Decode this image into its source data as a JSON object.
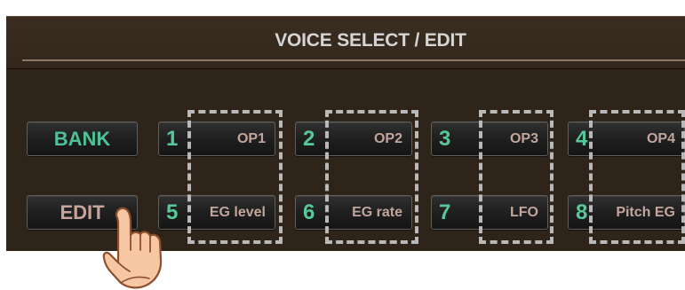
{
  "screen": {
    "title": "VOICE SELECT / EDIT"
  },
  "buttons": {
    "bank": "BANK",
    "edit": "EDIT"
  },
  "operator_buttons": [
    {
      "number": "1",
      "label": "OP1"
    },
    {
      "number": "2",
      "label": "OP2"
    },
    {
      "number": "3",
      "label": "OP3"
    },
    {
      "number": "4",
      "label": "OP4"
    }
  ],
  "edit_buttons": [
    {
      "number": "5",
      "label": "EG level"
    },
    {
      "number": "6",
      "label": "EG rate"
    },
    {
      "number": "7",
      "label": "LFO"
    },
    {
      "number": "8",
      "label": "Pitch EG"
    }
  ],
  "colors": {
    "panel": "#2f2419",
    "number_green": "#56c89a",
    "label_pink": "#c2a59b",
    "dash_gray": "#b9b9b9"
  },
  "icons": {
    "pointer": "pointing-hand-icon"
  }
}
